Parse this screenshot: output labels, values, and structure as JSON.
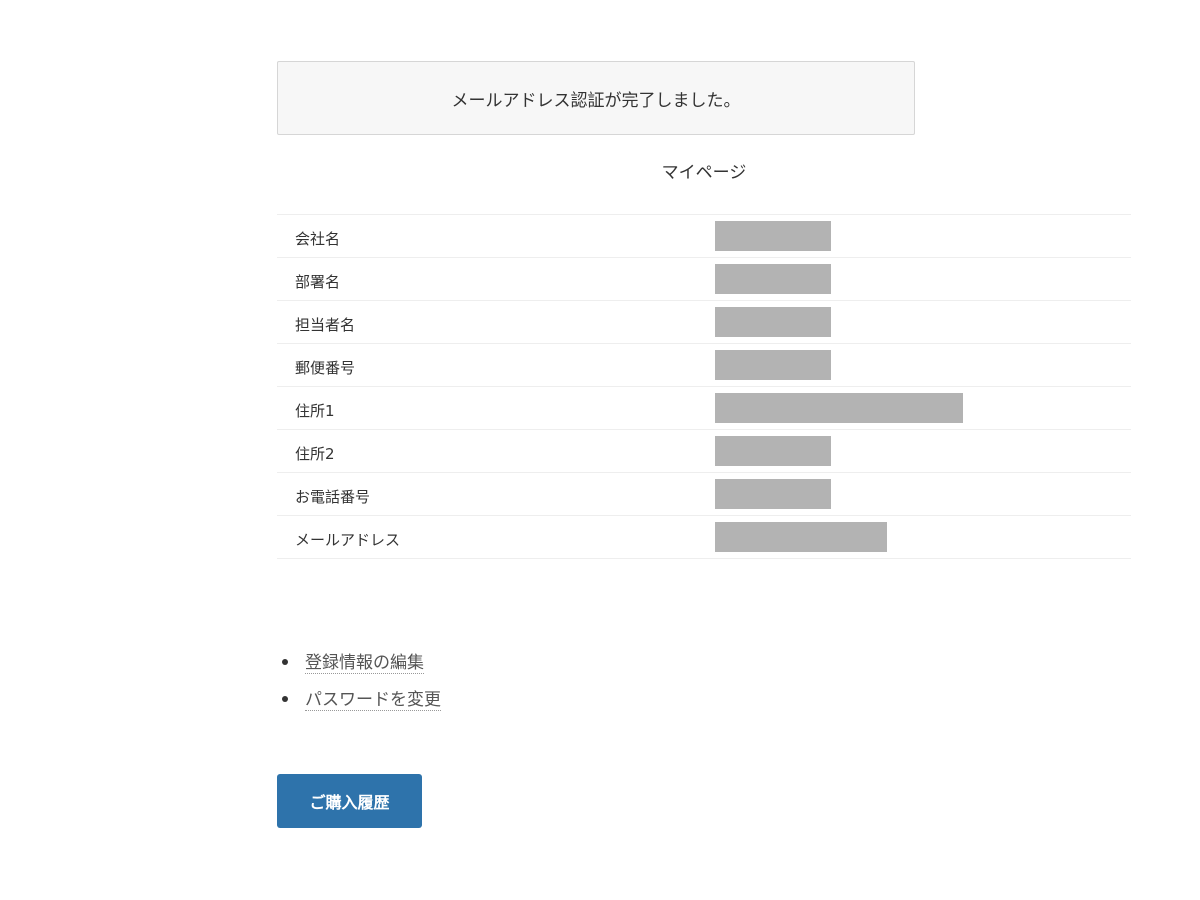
{
  "notice": {
    "message": "メールアドレス認証が完了しました。"
  },
  "page_title": "マイページ",
  "profile": {
    "rows": [
      {
        "label": "会社名",
        "value": "",
        "masked": true
      },
      {
        "label": "部署名",
        "value": "",
        "masked": true
      },
      {
        "label": "担当者名",
        "value": "",
        "masked": true
      },
      {
        "label": "郵便番号",
        "value": "",
        "masked": true
      },
      {
        "label": "住所1",
        "value": "",
        "masked": true
      },
      {
        "label": "住所2",
        "value": "",
        "masked": true
      },
      {
        "label": "お電話番号",
        "value": "",
        "masked": true
      },
      {
        "label": "メールアドレス",
        "value": "",
        "masked": true
      }
    ]
  },
  "links": [
    {
      "label": "登録情報の編集"
    },
    {
      "label": "パスワードを変更"
    }
  ],
  "buttons": {
    "history_label": "ご購入履歴"
  },
  "colors": {
    "primary_button": "#2e73ab",
    "mask": "#b3b3b3",
    "notice_bg": "#f7f7f7"
  }
}
